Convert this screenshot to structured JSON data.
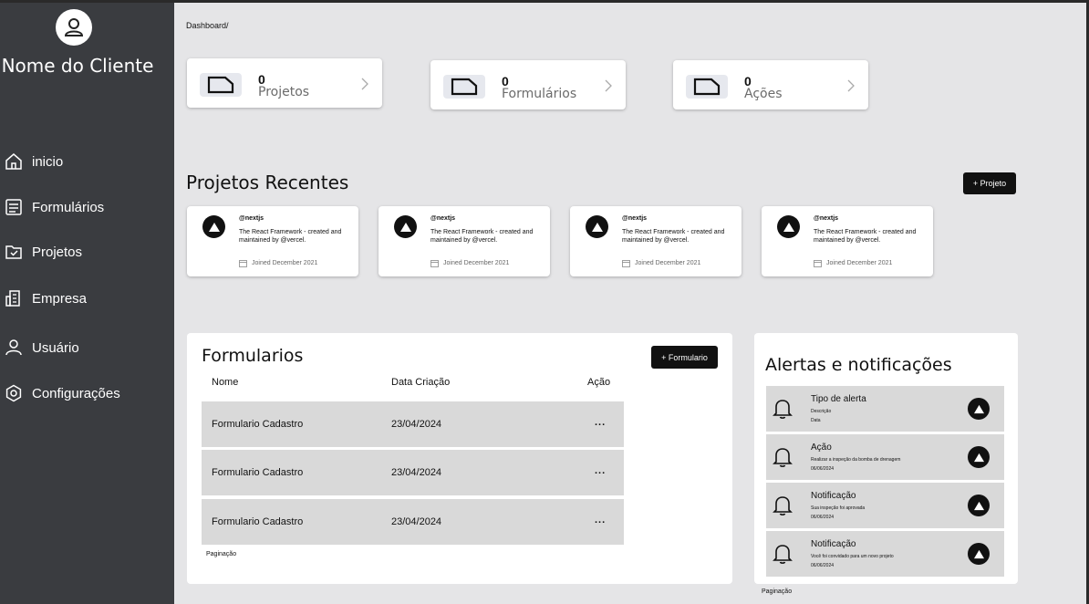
{
  "sidebar": {
    "client_name": "Nome do Cliente",
    "items": [
      {
        "label": "inicio",
        "icon": "home-icon"
      },
      {
        "label": "Formulários",
        "icon": "form-icon"
      },
      {
        "label": "Projetos",
        "icon": "project-icon"
      },
      {
        "label": "Empresa",
        "icon": "building-icon"
      },
      {
        "label": "Usuário",
        "icon": "user-icon"
      },
      {
        "label": "Configurações",
        "icon": "settings-icon"
      }
    ]
  },
  "breadcrumb": "Dashboard/",
  "stats": [
    {
      "value": "0",
      "label": "Projetos"
    },
    {
      "value": "0",
      "label": "Formulários"
    },
    {
      "value": "0",
      "label": "Ações"
    }
  ],
  "recent": {
    "title": "Projetos Recentes",
    "add_button": "+ Projeto",
    "cards": [
      {
        "handle": "@nextjs",
        "description": "The React Framework - created and maintained by @vercel.",
        "joined": "Joined December 2021"
      },
      {
        "handle": "@nextjs",
        "description": "The React Framework - created and maintained by @vercel.",
        "joined": "Joined December 2021"
      },
      {
        "handle": "@nextjs",
        "description": "The React Framework - created and maintained by @vercel.",
        "joined": "Joined December 2021"
      },
      {
        "handle": "@nextjs",
        "description": "The React Framework - created and maintained by @vercel.",
        "joined": "Joined December 2021"
      }
    ]
  },
  "forms": {
    "title": "Formularios",
    "add_button": "+ Formulario",
    "columns": [
      "Nome",
      "Data Criação",
      "Ação"
    ],
    "rows": [
      {
        "name": "Formulario Cadastro",
        "date": "23/04/2024",
        "action": "..."
      },
      {
        "name": "Formulario Cadastro",
        "date": "23/04/2024",
        "action": "..."
      },
      {
        "name": "Formulario Cadastro",
        "date": "23/04/2024",
        "action": "..."
      }
    ],
    "pagination": "Paginação"
  },
  "alerts": {
    "title": "Alertas e notificações",
    "items": [
      {
        "title": "Tipo de alerta",
        "description": "Descrição",
        "date": "Data"
      },
      {
        "title": "Ação",
        "description": "Realizar a inspeção da bomba de drenagem",
        "date": "06/06/2024"
      },
      {
        "title": "Notificação",
        "description": "Sua inspeção foi aprovada",
        "date": "06/06/2024"
      },
      {
        "title": "Notificação",
        "description": "Você foi convidado para um novo projeto",
        "date": "06/06/2024"
      }
    ],
    "pagination": "Paginação"
  }
}
